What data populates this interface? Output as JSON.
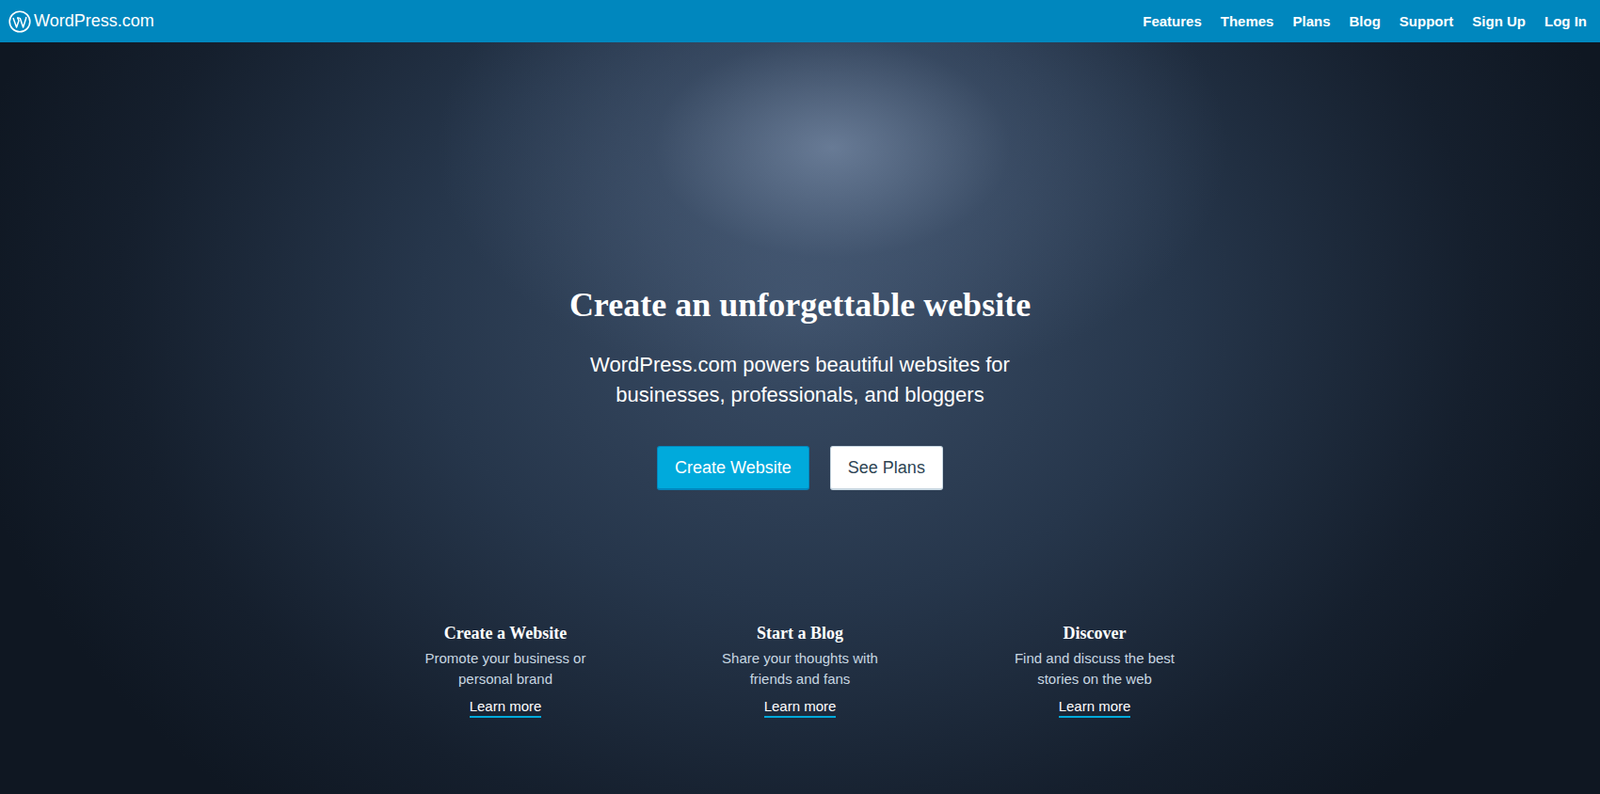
{
  "header": {
    "logo": "WordPress.com",
    "nav": [
      "Features",
      "Themes",
      "Plans",
      "Blog",
      "Support",
      "Sign Up",
      "Log In"
    ]
  },
  "hero": {
    "title": "Create an unforgettable website",
    "subtitle": "WordPress.com powers beautiful websites for businesses, professionals, and bloggers",
    "buttons": [
      {
        "label": "Create Website",
        "kind": "primary"
      },
      {
        "label": "See Plans",
        "kind": "secondary"
      }
    ]
  },
  "features": [
    {
      "title": "Create a Website",
      "text": "Promote your business or personal brand",
      "link": "Learn more"
    },
    {
      "title": "Start a Blog",
      "text": "Share your thoughts with friends and fans",
      "link": "Learn more"
    },
    {
      "title": "Discover",
      "text": "Find and discuss the best stories on the web",
      "link": "Learn more"
    }
  ]
}
